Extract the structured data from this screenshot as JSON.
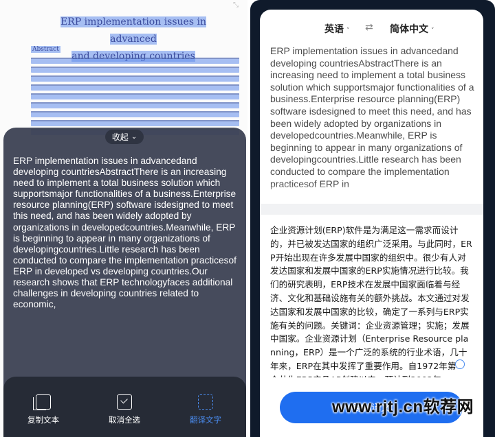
{
  "left_panel": {
    "document": {
      "title_line1": "ERP implementation issues in advanced",
      "title_line2": "and developing countries",
      "abstract_heading": "Abstract"
    },
    "collapse_label": "收起",
    "recognized_text": "ERP implementation issues in advancedand developing countriesAbstractThere is an increasing need to implement a total business solution which supportsmajor functionalities of a business.Enterprise resource planning(ERP) software isdesigned to meet this need,  and has been widely adopted by organizations in developedcountries.Meanwhile,  ERP is beginning to appear in many organizations of developingcountries.Little research has been conducted to compare the implementation practicesof ERP in developed vs developing countries.Our research shows that ERP technologyfaces additional challenges in developing countries related to economic,",
    "toolbar": {
      "copy_text": "复制文本",
      "deselect_all": "取消全选",
      "translate_text": "翻译文字"
    }
  },
  "right_panel": {
    "source_language": "英语",
    "target_language": "简体中文",
    "source_text": "ERP implementation issues in advancedand developing countriesAbstractThere is an increasing need to implement a total business solution which supportsmajor functionalities of a business.Enterprise resource planning(ERP) software isdesigned to meet this need,  and has been widely adopted by organizations in developedcountries.Meanwhile, ERP is beginning to appear in many organizations of developingcountries.Little research has been conducted to compare the implementation practicesof ERP in",
    "translated_text": "企业资源计划(ERP)软件是为满足这一需求而设计的，并已被发达国家的组织广泛采用。与此同时，ERP开始出现在许多发展中国家的组织中。很少有人对发达国家和发展中国家的ERP实施情况进行比较。我们的研究表明，ERP技术在发展中国家面临着与经济、文化和基础设施有关的额外挑战。本文通过对发达国家和发展中国家的比较，确定了一系列与ERP实施有关的问题。关键词：企业资源管理；实施；发展中国家。企业资源计划（Enterprise Resource planning，ERP）是一个广泛的系统的行业术语，几十年来，ERP在其中发挥了重要作用。自1972年第一个共生ERP产品AP创建以来，预计到2002年",
    "copy_button_label": "复制译文"
  },
  "watermark": "www.rjtj.cn软荐网",
  "colors": {
    "accent": "#1f6ef0",
    "highlight": "#608ceb",
    "sheet_bg": "#3a4052",
    "toolbar_bg": "#262b36"
  }
}
